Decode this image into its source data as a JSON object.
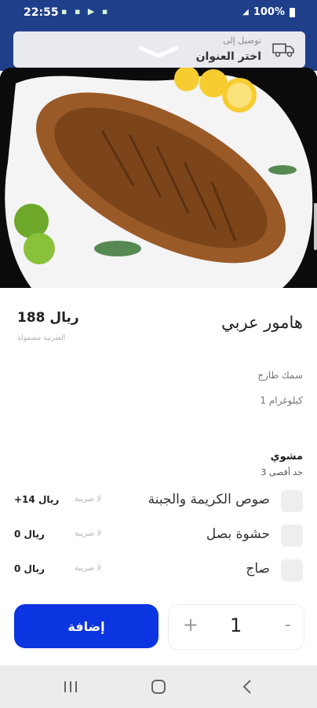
{
  "status_bar": {
    "time": "22:55",
    "battery": "100%"
  },
  "header": {
    "deliver_to": "توصيل إلى",
    "choose_address": "اختر العنوان"
  },
  "product": {
    "name": "هامور عربي",
    "price": "188 ريال",
    "tax_note": "الضريبة مشمولة",
    "description": "سمك طازج",
    "weight": "1 كيلوغرام"
  },
  "options_group": {
    "title": "مشوي",
    "limit": "حد أقصى 3",
    "items": [
      {
        "label": "صوص الكريمة والجبنة",
        "tax": "لا ضريبة",
        "price": "+14 ريال"
      },
      {
        "label": "حشوة بصل",
        "tax": "لا ضريبة",
        "price": "0 ريال"
      },
      {
        "label": "صاج",
        "tax": "لا ضريبة",
        "price": "0 ريال"
      }
    ]
  },
  "cart": {
    "add_label": "إضافة",
    "quantity": "1",
    "plus": "+",
    "minus": "-"
  },
  "colors": {
    "primary": "#0b35e0",
    "header_bg": "#1f3f8a"
  },
  "icons": {
    "truck": "truck-icon",
    "chevron": "chevron-down-icon",
    "nav_recent": "recent-apps-icon",
    "nav_home": "home-icon",
    "nav_back": "back-icon"
  }
}
